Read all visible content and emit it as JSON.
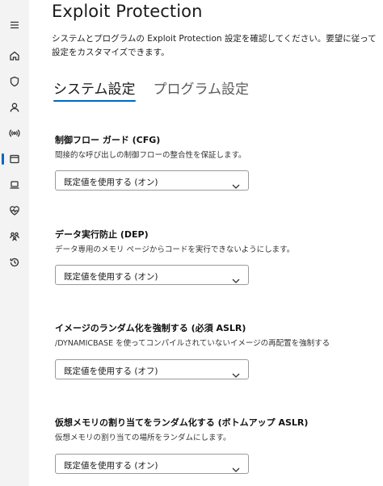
{
  "page": {
    "title": "Exploit Protection",
    "description": "システムとプログラムの Exploit Protection 設定を確認してください。要望に従って設定をカスタマイズできます。"
  },
  "tabs": [
    {
      "label": "システム設定",
      "selected": true
    },
    {
      "label": "プログラム設定",
      "selected": false
    }
  ],
  "settings": [
    {
      "title": "制御フロー ガード (CFG)",
      "description": "間接的な呼び出しの制御フローの整合性を保証します。",
      "value": "既定値を使用する (オン)"
    },
    {
      "title": "データ実行防止 (DEP)",
      "description": "データ専用のメモリ ページからコードを実行できないようにします。",
      "value": "既定値を使用する (オン)"
    },
    {
      "title": "イメージのランダム化を強制する (必須 ASLR)",
      "description": "/DYNAMICBASE を使ってコンパイルされていないイメージの再配置を強制する",
      "value": "既定値を使用する (オフ)"
    },
    {
      "title": "仮想メモリの割り当てをランダム化する (ボトムアップ ASLR)",
      "description": "仮想メモリの割り当ての場所をランダムにします。",
      "value": "既定値を使用する (オン)"
    }
  ],
  "nav_rail": {
    "icons": [
      "hamburger-icon",
      "home-icon",
      "shield-icon",
      "account-icon",
      "network-icon",
      "app-browser-icon",
      "device-security-icon",
      "health-icon",
      "family-icon",
      "history-icon"
    ],
    "active": "app-browser-icon",
    "accent_color": "#0067c0"
  }
}
